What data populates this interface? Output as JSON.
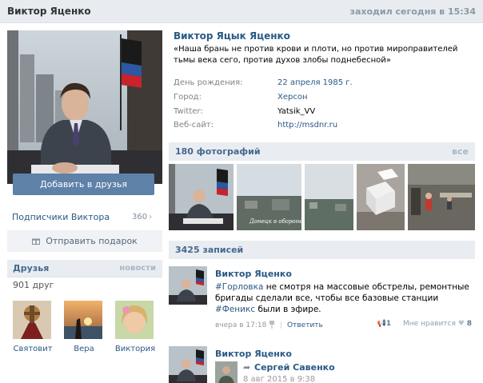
{
  "header": {
    "name": "Виктор Яценко",
    "last_seen": "заходил сегодня в 15:34"
  },
  "profile": {
    "full_name": "Виктор Яцык Яценко",
    "status": "«Наша брань не против крови и плоти, но против мироправителей тьмы века сего, против духов злобы поднебесной»",
    "info": [
      {
        "label": "День рождения:",
        "value": "22 апреля 1985 г."
      },
      {
        "label": "Город:",
        "value": "Херсон"
      },
      {
        "label": "Twitter:",
        "value": "Yatsik_VV"
      },
      {
        "label": "Веб-сайт:",
        "value": "http://msdnr.ru"
      }
    ]
  },
  "actions": {
    "add_friend": "Добавить в друзья",
    "subscribers_label": "Подписчики Виктора",
    "subscribers_count": "360",
    "gift": "Отправить подарок"
  },
  "friends": {
    "title": "Друзья",
    "news_link": "новости",
    "count": "901 друг",
    "items": [
      {
        "name": "Святовит"
      },
      {
        "name": "Вера"
      },
      {
        "name": "Виктория"
      }
    ]
  },
  "photos": {
    "title": "180 фотографий",
    "all_link": "все",
    "caption_text": "Донецк в обороне"
  },
  "wall": {
    "title": "3425 записей",
    "posts": [
      {
        "author": "Виктор Яценко",
        "tag1": "#Горловка",
        "text1": " не смотря на массовые обстрелы, ремонтные бригады сделали все, чтобы все базовые станции ",
        "tag2": "#Феникс",
        "text2": " были в эфире.",
        "time": "вчера в 17:18",
        "reply": "Ответить",
        "reposts": "1",
        "like_label": "Мне нравится",
        "likes": "8"
      },
      {
        "author": "Виктор Яценко",
        "repost_author": "Сергей Савенко",
        "repost_date": "8 авг 2015 в 9:38"
      }
    ]
  },
  "colors": {
    "link": "#2a5885",
    "button": "#5e81a8",
    "section_bg": "#e9edf1"
  }
}
